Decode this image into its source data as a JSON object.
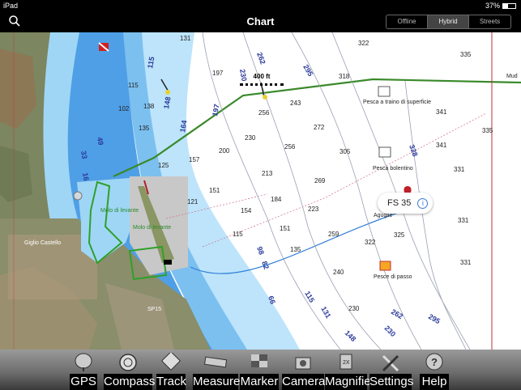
{
  "status_bar": {
    "device": "iPad",
    "battery": "37%"
  },
  "nav": {
    "title": "Chart",
    "map_modes": [
      "Offline",
      "Hybrid",
      "Streets"
    ],
    "active_mode": "Hybrid"
  },
  "scale": {
    "label": "400 ft"
  },
  "map": {
    "depths": [
      "131",
      "322",
      "335",
      "197",
      "318",
      "115",
      "102",
      "138",
      "243",
      "256",
      "272",
      "341",
      "135",
      "230",
      "256",
      "305",
      "200",
      "213",
      "269",
      "125",
      "157",
      "151",
      "154",
      "184",
      "223",
      "328",
      "121",
      "115",
      "151",
      "135",
      "259",
      "325",
      "322",
      "240",
      "230",
      "335",
      "341",
      "331",
      "331",
      "331"
    ],
    "contours": [
      "115",
      "148",
      "164",
      "197",
      "230",
      "262",
      "295",
      "328",
      "98",
      "82",
      "66",
      "115",
      "131",
      "148",
      "230",
      "262",
      "295",
      "49",
      "33",
      "16"
    ],
    "places": {
      "giglio_castello": "Giglio Castello",
      "molo": "Molo di levante",
      "poi_pesca_traino": "Pesca a traino di superficie",
      "poi_aguglie": "Aguglie",
      "poi_pesce_passo": "Pesce di passo",
      "poi_pesca_bolentino": "Pesca bolentino",
      "road_sp": "SP15",
      "mud": "Mud"
    },
    "callout": "FS 35"
  },
  "toolbar": {
    "items": [
      {
        "label": "GPS",
        "icon": "satellite-dish-icon"
      },
      {
        "label": "Compass",
        "icon": "compass-icon"
      },
      {
        "label": "Track",
        "icon": "track-sign-icon"
      },
      {
        "label": "Measure",
        "icon": "ruler-icon"
      },
      {
        "label": "Marker",
        "icon": "marker-flag-icon"
      },
      {
        "label": "Camera",
        "icon": "camera-icon"
      },
      {
        "label": "Magnifier",
        "icon": "magnifier-icon"
      },
      {
        "label": "Settings",
        "icon": "tools-icon"
      },
      {
        "label": "Help",
        "icon": "help-icon"
      }
    ]
  },
  "colors": {
    "shallow_water": "#9fd6f5",
    "mid_water": "#5aa8e8",
    "deep_blue": "#2f7fd8",
    "route": "#3a8a2a",
    "land": "#7a8a5a"
  }
}
